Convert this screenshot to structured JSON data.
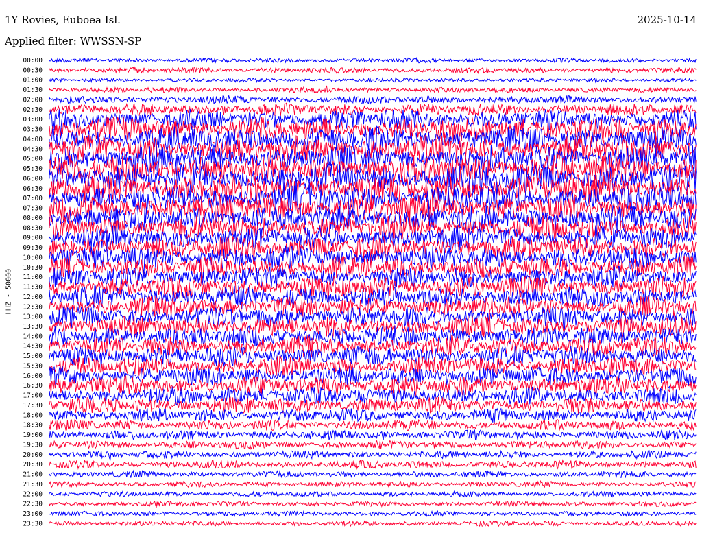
{
  "header": {
    "station": "1Y Rovies, Euboea Isl.",
    "date": "2025-10-14",
    "filter": "Applied filter: WWSSN-SP"
  },
  "chart_data": {
    "type": "line",
    "title": "1Y Rovies, Euboea Isl.",
    "subtitle": "Applied filter: WWSSN-SP",
    "ylabel": "HHZ - 50000",
    "xlabel": "",
    "row_labels": [
      "00:00",
      "00:30",
      "01:00",
      "01:30",
      "02:00",
      "02:30",
      "03:00",
      "03:30",
      "04:00",
      "04:30",
      "05:00",
      "05:30",
      "06:00",
      "06:30",
      "07:00",
      "07:30",
      "08:00",
      "08:30",
      "09:00",
      "09:30",
      "10:00",
      "10:30",
      "11:00",
      "11:30",
      "12:00",
      "12:30",
      "13:00",
      "13:30",
      "14:00",
      "14:30",
      "15:00",
      "15:30",
      "16:00",
      "16:30",
      "17:00",
      "17:30",
      "18:00",
      "18:30",
      "19:00",
      "19:30",
      "20:00",
      "20:30",
      "21:00",
      "21:30",
      "22:00",
      "22:30",
      "23:00",
      "23:30"
    ],
    "series_colors": [
      "#0000ff",
      "#ff0033"
    ],
    "row_amplitude_relative": [
      0.08,
      0.12,
      0.06,
      0.1,
      0.2,
      0.35,
      0.65,
      0.8,
      0.85,
      0.9,
      0.9,
      0.95,
      0.95,
      0.95,
      0.9,
      0.9,
      0.85,
      0.8,
      0.75,
      0.75,
      0.75,
      0.7,
      0.7,
      0.7,
      0.7,
      0.65,
      0.65,
      0.65,
      0.65,
      0.65,
      0.65,
      0.6,
      0.6,
      0.6,
      0.55,
      0.5,
      0.4,
      0.3,
      0.25,
      0.2,
      0.2,
      0.2,
      0.15,
      0.12,
      0.1,
      0.1,
      0.1,
      0.1
    ],
    "grid": false
  }
}
